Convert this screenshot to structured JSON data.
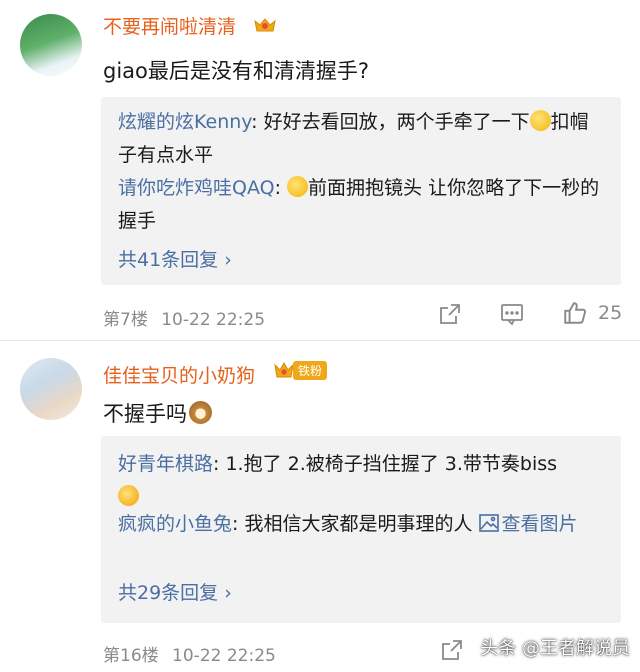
{
  "comments": [
    {
      "username": "不要再闹啦清清",
      "text": "giao最后是没有和清清握手?",
      "replies": [
        {
          "name": "炫耀的炫Kenny",
          "text": ": 好好去看回放，两个手牵了一下",
          "text2": "扣帽子有点水平"
        },
        {
          "name": "请你吃炸鸡哇QAQ",
          "text": ": ",
          "text2": "前面拥抱镜头 让你忽略了下一秒的握手"
        }
      ],
      "more": "共41条回复 ›",
      "floor": "第7楼",
      "time": "10-22 22:25",
      "like_count": "25"
    },
    {
      "username": "佳佳宝贝的小奶狗",
      "badge": "铁粉",
      "text": "不握手吗",
      "replies": [
        {
          "name": "好青年棋路",
          "text": ": 1.抱了 2.被椅子挡住握了 3.带节奏biss"
        },
        {
          "name": "疯疯的小鱼兔",
          "text": ": 我相信大家都是明事理的人 ",
          "link": "查看图片"
        }
      ],
      "more": "共29条回复 ›",
      "floor": "第16楼",
      "time": "10-22 22:25"
    }
  ],
  "watermark": "头条 @王者解说员",
  "colors": {
    "username": "#e8611c",
    "reply_name": "#4a6fa3",
    "meta": "#8a8a8a",
    "reply_bg": "#f2f2f2"
  },
  "icons": [
    "share-icon",
    "comment-icon",
    "like-icon",
    "image-link-icon"
  ]
}
